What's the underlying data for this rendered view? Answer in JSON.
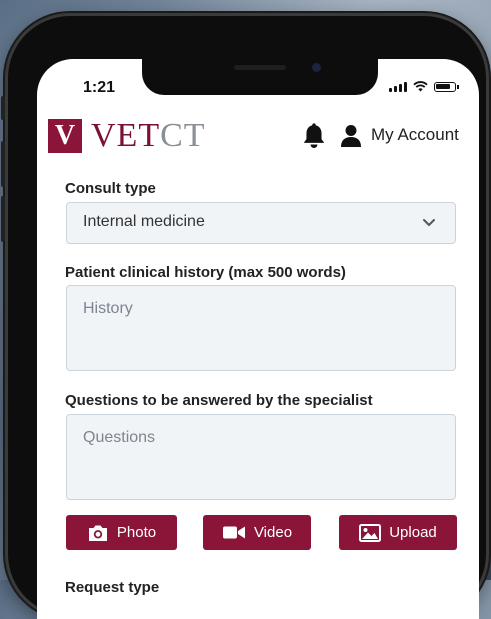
{
  "status_bar": {
    "time": "1:21"
  },
  "header": {
    "brand": "VETCT",
    "brand_part_a": "VET",
    "brand_part_b": "CT",
    "logo_letter": "V",
    "account_label": "My Account"
  },
  "form": {
    "consult_type": {
      "label": "Consult type",
      "value": "Internal medicine"
    },
    "history": {
      "label": "Patient clinical history (max 500 words)",
      "placeholder": "History"
    },
    "questions": {
      "label": "Questions to be answered by the specialist",
      "placeholder": "Questions"
    },
    "buttons": {
      "photo": "Photo",
      "video": "Video",
      "upload": "Upload"
    },
    "request_type": {
      "label": "Request type"
    }
  },
  "colors": {
    "brand": "#8b1538",
    "field_bg": "#f1f4f7",
    "field_border": "#cbd3dc"
  },
  "icons": [
    "bell-icon",
    "user-icon",
    "chevron-down-icon",
    "camera-icon",
    "video-icon",
    "image-icon",
    "signal-icon",
    "wifi-icon",
    "battery-icon"
  ]
}
